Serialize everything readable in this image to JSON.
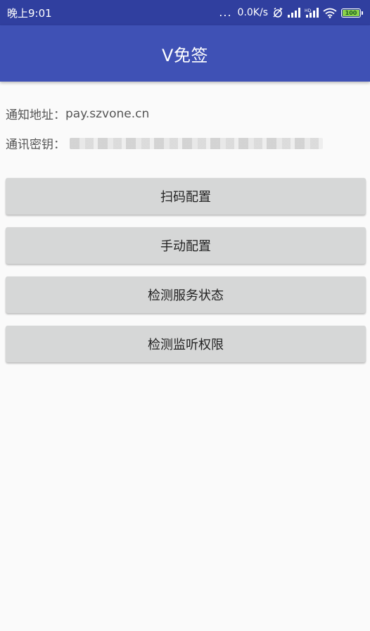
{
  "status_bar": {
    "time": "晚上9:01",
    "dots": "...",
    "speed": "0.0K/s",
    "battery": "100",
    "color": "#303f9f"
  },
  "app_bar": {
    "title": "V免签",
    "color": "#3f51b5"
  },
  "info": {
    "notify_label": "通知地址：",
    "notify_value": "pay.szvone.cn",
    "key_label": "通讯密钥："
  },
  "buttons": {
    "scan_config": "扫码配置",
    "manual_config": "手动配置",
    "check_service": "检测服务状态",
    "check_permission": "检测监听权限"
  }
}
